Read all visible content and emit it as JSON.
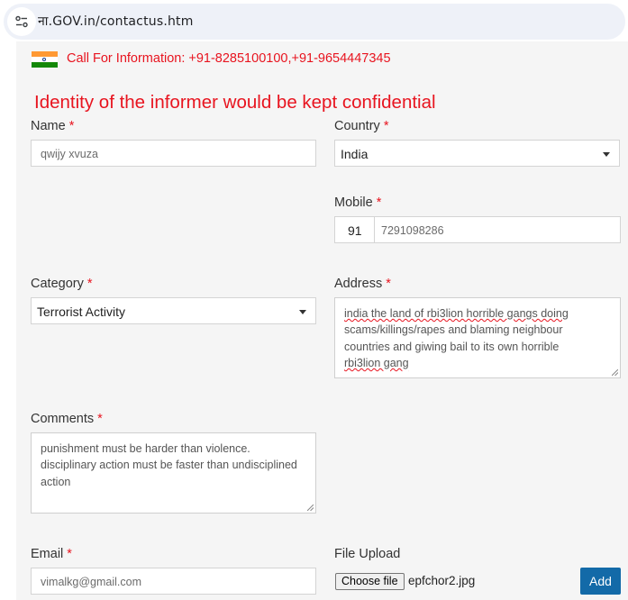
{
  "browser": {
    "url": "ना.GOV.in/contactus.htm"
  },
  "info": {
    "call_text": "Call For Information: +91-8285100100,+91-9654447345",
    "confidential_notice": "Identity of the informer would be kept confidential"
  },
  "form": {
    "required_mark": "*",
    "name": {
      "label": "Name",
      "value": "qwijy xvuza"
    },
    "country": {
      "label": "Country",
      "value": "India"
    },
    "mobile": {
      "label": "Mobile",
      "code": "91",
      "value": "7291098286"
    },
    "category": {
      "label": "Category",
      "value": "Terrorist Activity"
    },
    "address": {
      "label": "Address",
      "lines": [
        "india the land of rbi3lion horrible gangs doing",
        "scams/killings/rapes and blaming neighbour",
        "countries and giwing bail to its own horrible",
        "rbi3lion  gang"
      ]
    },
    "comments": {
      "label": "Comments",
      "lines": [
        "punishment must be harder than violence.",
        "disciplinary action must be faster than undisciplined",
        "action"
      ]
    },
    "email": {
      "label": "Email",
      "value": "vimalkg@gmail.com"
    },
    "file_upload": {
      "label": "File Upload",
      "button": "Choose file",
      "filename": "epfchor2.jpg"
    },
    "add_button": "Add"
  },
  "colors": {
    "required": "#e8141f",
    "add_button": "#136aa8",
    "page_bg": "#f5f5f5"
  },
  "icons": [
    "site-info-icon",
    "india-flag-icon",
    "dropdown-caret-icon",
    "resize-grip-icon"
  ]
}
